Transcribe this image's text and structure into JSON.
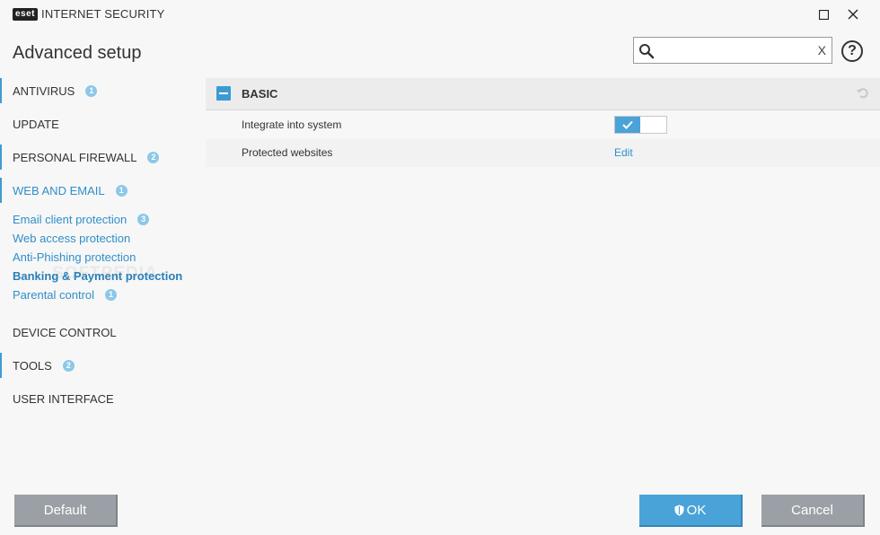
{
  "app": {
    "logo_text": "eset",
    "product_name": "INTERNET SECURITY"
  },
  "window_controls": {
    "maximize": "□",
    "close": "✕"
  },
  "page_title": "Advanced setup",
  "search": {
    "placeholder": "",
    "value": "",
    "clear_label": "X"
  },
  "help_label": "?",
  "sidebar": {
    "sections": [
      {
        "label": "ANTIVIRUS",
        "badge": "1"
      },
      {
        "label": "UPDATE",
        "badge": ""
      },
      {
        "label": "PERSONAL FIREWALL",
        "badge": "2"
      },
      {
        "label": "WEB AND EMAIL",
        "badge": "1"
      },
      {
        "label": "DEVICE CONTROL",
        "badge": ""
      },
      {
        "label": "TOOLS",
        "badge": "2"
      },
      {
        "label": "USER INTERFACE",
        "badge": ""
      }
    ],
    "web_and_email_items": [
      {
        "label": "Email client protection",
        "badge": "3"
      },
      {
        "label": "Web access protection",
        "badge": ""
      },
      {
        "label": "Anti-Phishing protection",
        "badge": ""
      },
      {
        "label": "Banking & Payment protection",
        "badge": "",
        "active": true
      },
      {
        "label": "Parental control",
        "badge": "1"
      }
    ]
  },
  "main": {
    "section_title": "BASIC",
    "rows": [
      {
        "label": "Integrate into system",
        "control": "toggle",
        "enabled": true
      },
      {
        "label": "Protected websites",
        "control": "link",
        "link_text": "Edit"
      }
    ]
  },
  "footer": {
    "default_label": "Default",
    "ok_label": "OK",
    "cancel_label": "Cancel"
  },
  "watermark": "SOFTPEDIA",
  "colors": {
    "accent": "#4aa3d8",
    "link": "#2f8fc9",
    "badge": "#8cc8e8",
    "gray_button": "#9aa0a5"
  }
}
